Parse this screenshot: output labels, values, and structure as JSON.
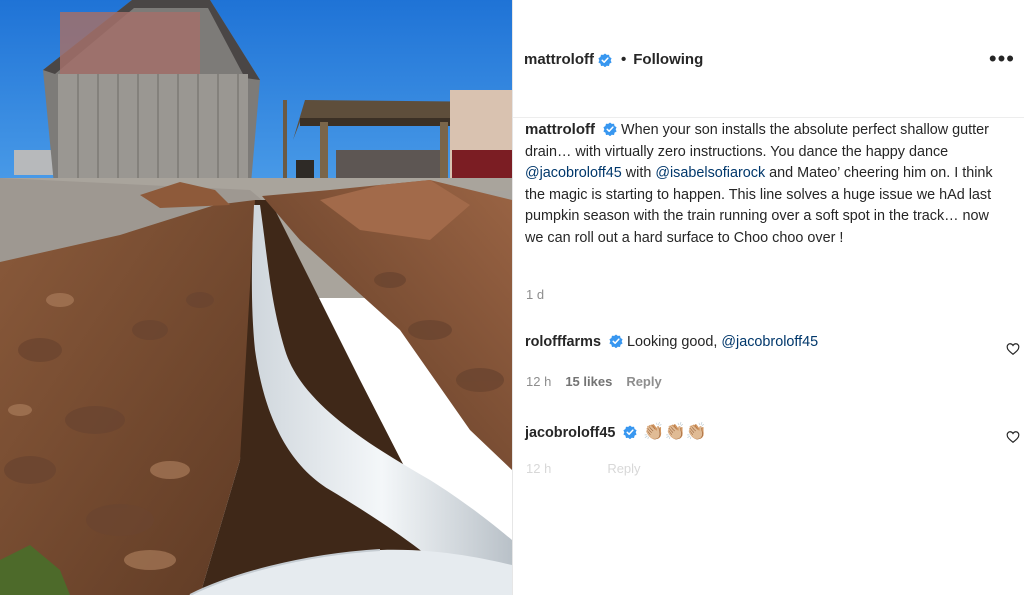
{
  "post": {
    "author": "mattroloff",
    "follow_label": "Following",
    "dot": "•",
    "more_icon": "more-horizontal-icon",
    "caption": {
      "author": "mattroloff",
      "part1": "When your son installs the absolute perfect shallow gutter drain… with virtually zero instructions. You dance the happy dance ",
      "mention1": "@jacobroloff45",
      "part2": " with ",
      "mention2": "@isabelsofiarock",
      "part3": " and Mateo’ cheering him on. I think the magic is starting to happen. This line solves a huge issue we hAd last pumpkin season with the train running over a soft spot in the track… now we can roll out a hard surface to Choo choo over !"
    },
    "age": "1 d"
  },
  "comments": [
    {
      "author": "rolofffarms",
      "text": "Looking good, ",
      "mention": "@jacobroloff45",
      "time": "12 h",
      "likes": "15 likes",
      "reply": "Reply"
    },
    {
      "author": "jacobroloff45",
      "emoji": "👏🏼👏🏼👏🏼",
      "time": "12 h",
      "reply": "Reply"
    }
  ],
  "colors": {
    "verified": "#3897f0",
    "mention": "#00376b",
    "muted": "#8e8e8e"
  }
}
